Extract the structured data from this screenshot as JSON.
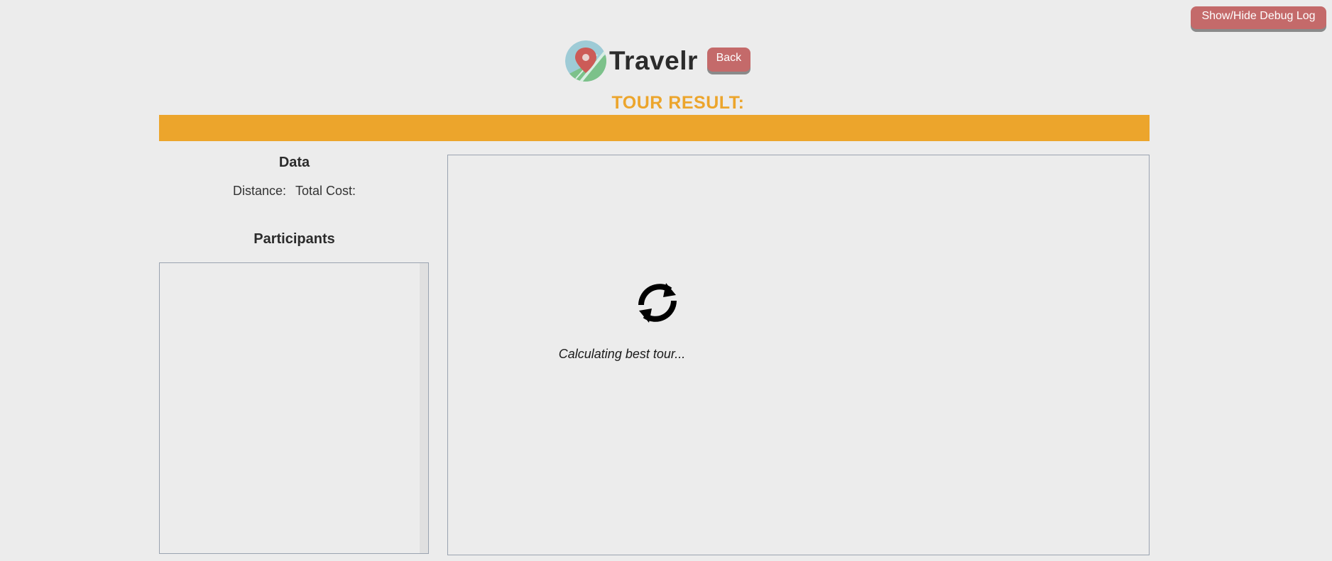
{
  "debug": {
    "toggle_label": "Show/Hide Debug Log"
  },
  "header": {
    "logo_icon": "map-pin-icon",
    "title": "Travelr",
    "back_label": "Back"
  },
  "result": {
    "heading": "TOUR RESULT:"
  },
  "data_panel": {
    "heading": "Data",
    "distance_label": "Distance:",
    "total_cost_label": "Total Cost:"
  },
  "participants": {
    "heading": "Participants",
    "items": []
  },
  "map": {
    "spinner_icon": "refresh-icon",
    "loading_text": "Calculating best tour..."
  },
  "colors": {
    "background": "#ececec",
    "accent": "#eca52c",
    "button": "#c46a6a",
    "text": "#2b2b2b"
  }
}
